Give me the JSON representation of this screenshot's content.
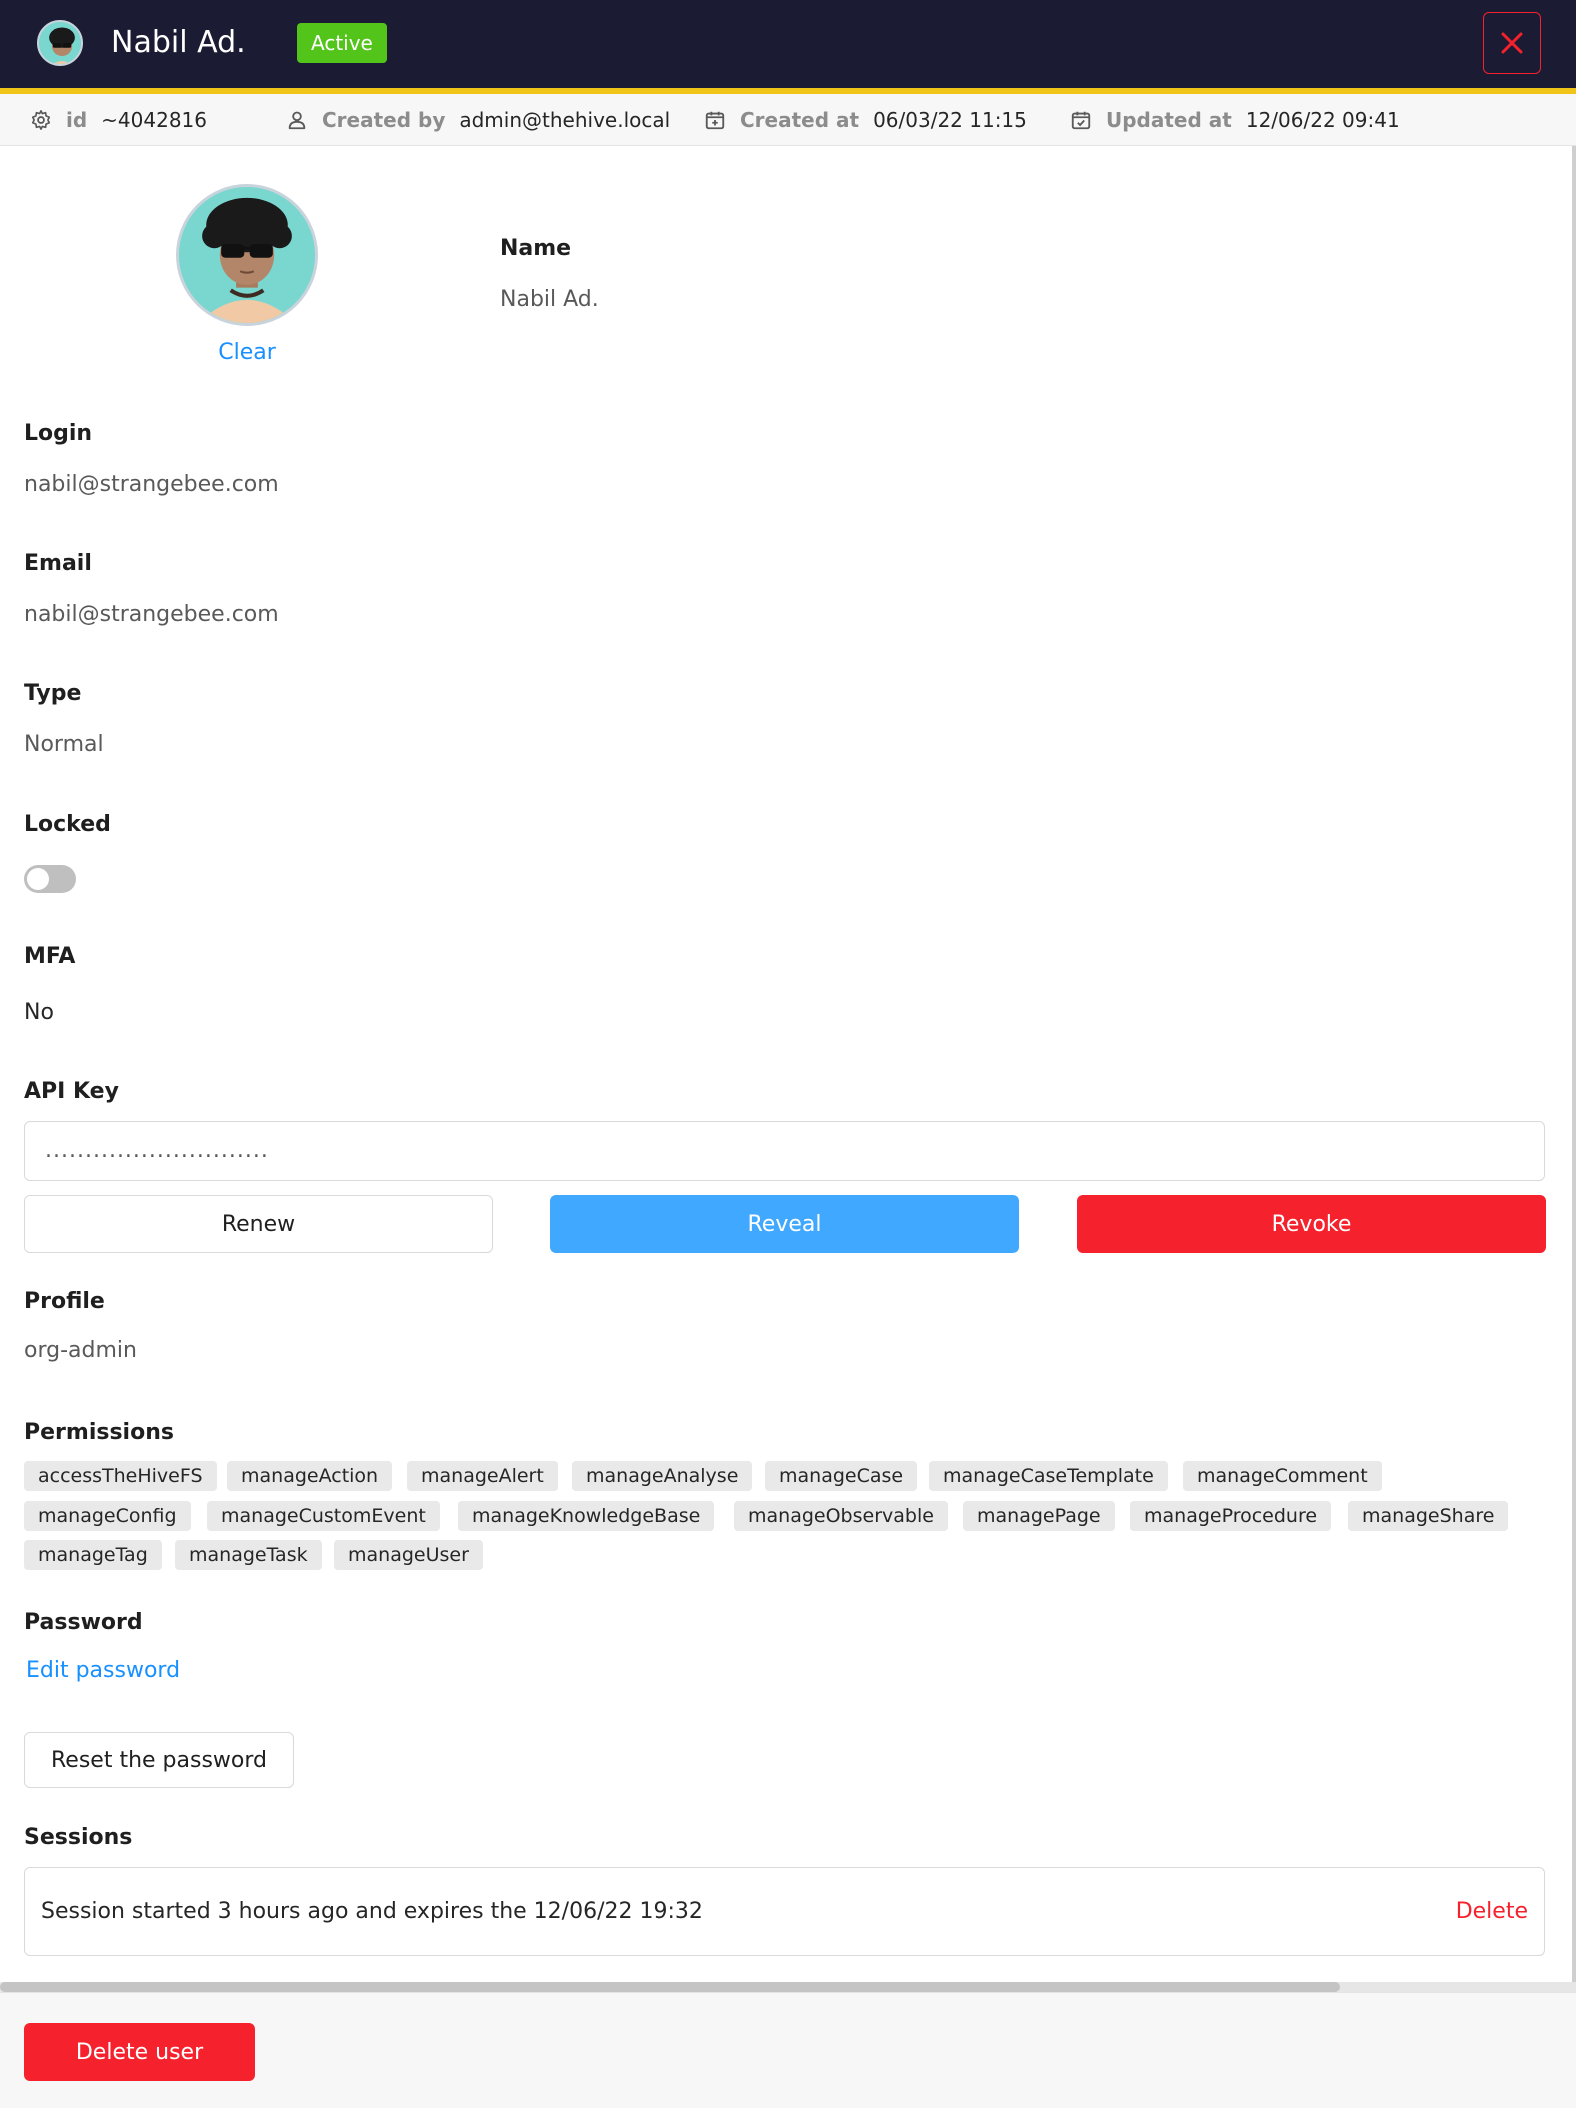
{
  "header": {
    "title": "Nabil Ad.",
    "status": "Active",
    "close_icon": "close-icon"
  },
  "meta": {
    "id_label": "id",
    "id_value": "~4042816",
    "created_by_label": "Created by",
    "created_by_value": "admin@thehive.local",
    "created_at_label": "Created at",
    "created_at_value": "06/03/22 11:15",
    "updated_at_label": "Updated at",
    "updated_at_value": "12/06/22 09:41"
  },
  "avatar": {
    "clear_label": "Clear"
  },
  "fields": {
    "name_label": "Name",
    "name_value": "Nabil Ad.",
    "login_label": "Login",
    "login_value": "nabil@strangebee.com",
    "email_label": "Email",
    "email_value": "nabil@strangebee.com",
    "type_label": "Type",
    "type_value": "Normal",
    "locked_label": "Locked",
    "locked_on": false,
    "mfa_label": "MFA",
    "mfa_value": "No",
    "api_key_label": "API Key",
    "api_key_value": "............................",
    "profile_label": "Profile",
    "profile_value": "org-admin",
    "permissions_label": "Permissions",
    "password_label": "Password",
    "sessions_label": "Sessions"
  },
  "api_actions": {
    "renew": "Renew",
    "reveal": "Reveal",
    "revoke": "Revoke"
  },
  "permissions": [
    "accessTheHiveFS",
    "manageAction",
    "manageAlert",
    "manageAnalyse",
    "manageCase",
    "manageCaseTemplate",
    "manageComment",
    "manageConfig",
    "manageCustomEvent",
    "manageKnowledgeBase",
    "manageObservable",
    "managePage",
    "manageProcedure",
    "manageShare",
    "manageTag",
    "manageTask",
    "manageUser"
  ],
  "password": {
    "edit_link": "Edit password",
    "reset_button": "Reset the password"
  },
  "sessions": [
    {
      "text": "Session started 3 hours ago and expires the 12/06/22 19:32",
      "delete_label": "Delete"
    }
  ],
  "footer": {
    "delete_user": "Delete user"
  },
  "colors": {
    "topbar": "#1b1b33",
    "accent_stripe": "#f0c419",
    "active_badge": "#52c41a",
    "link": "#1890ff",
    "danger": "#f5222d",
    "primary": "#40a9ff"
  }
}
